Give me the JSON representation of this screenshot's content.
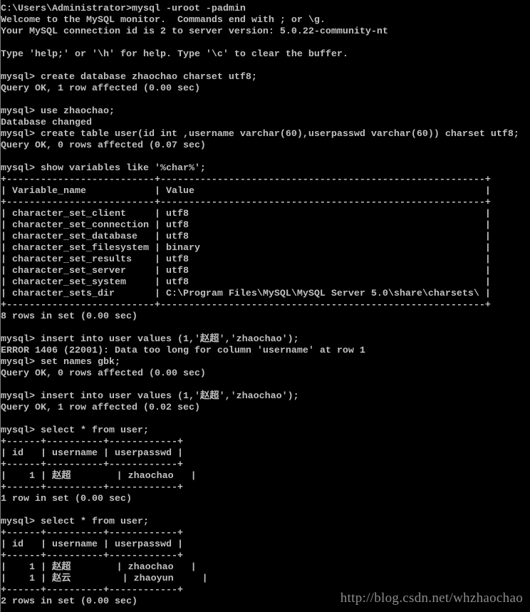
{
  "window": {
    "type": "Windows command prompt",
    "background": "#000000",
    "foreground": "#c0c0c0"
  },
  "lines": [
    "C:\\Users\\Administrator>mysql -uroot -padmin",
    "Welcome to the MySQL monitor.  Commands end with ; or \\g.",
    "Your MySQL connection id is 2 to server version: 5.0.22-community-nt",
    "",
    "Type 'help;' or '\\h' for help. Type '\\c' to clear the buffer.",
    "",
    "mysql> create database zhaochao charset utf8;",
    "Query OK, 1 row affected (0.00 sec)",
    "",
    "mysql> use zhaochao;",
    "Database changed",
    "mysql> create table user(id int ,username varchar(60),userpasswd varchar(60)) charset utf8;",
    "Query OK, 0 rows affected (0.07 sec)",
    "",
    "mysql> show variables like '%char%';",
    "+--------------------------+---------------------------------------------------------+",
    "| Variable_name            | Value                                                   |",
    "+--------------------------+---------------------------------------------------------+",
    "| character_set_client     | utf8                                                    |",
    "| character_set_connection | utf8                                                    |",
    "| character_set_database   | utf8                                                    |",
    "| character_set_filesystem | binary                                                  |",
    "| character_set_results    | utf8                                                    |",
    "| character_set_server     | utf8                                                    |",
    "| character_set_system     | utf8                                                    |",
    "| character_sets_dir       | C:\\Program Files\\MySQL\\MySQL Server 5.0\\share\\charsets\\ |",
    "+--------------------------+---------------------------------------------------------+",
    "8 rows in set (0.00 sec)",
    "",
    "mysql> insert into user values (1,'赵超','zhaochao');",
    "ERROR 1406 (22001): Data too long for column 'username' at row 1",
    "mysql> set names gbk;",
    "Query OK, 0 rows affected (0.00 sec)",
    "",
    "mysql> insert into user values (1,'赵超','zhaochao');",
    "Query OK, 1 row affected (0.02 sec)",
    "",
    "mysql> select * from user;",
    "+------+----------+------------+",
    "| id   | username | userpasswd |",
    "+------+----------+------------+",
    "|    1 | 赵超        | zhaochao   |",
    "+------+----------+------------+",
    "1 row in set (0.00 sec)",
    "",
    "mysql> select * from user;",
    "+------+----------+------------+",
    "| id   | username | userpasswd |",
    "+------+----------+------------+",
    "|    1 | 赵超        | zhaochao   |",
    "|    1 | 赵云         | zhaoyun     |",
    "+------+----------+------------+",
    "2 rows in set (0.00 sec)"
  ],
  "watermark": "http://blog.csdn.net/whzhaochao"
}
